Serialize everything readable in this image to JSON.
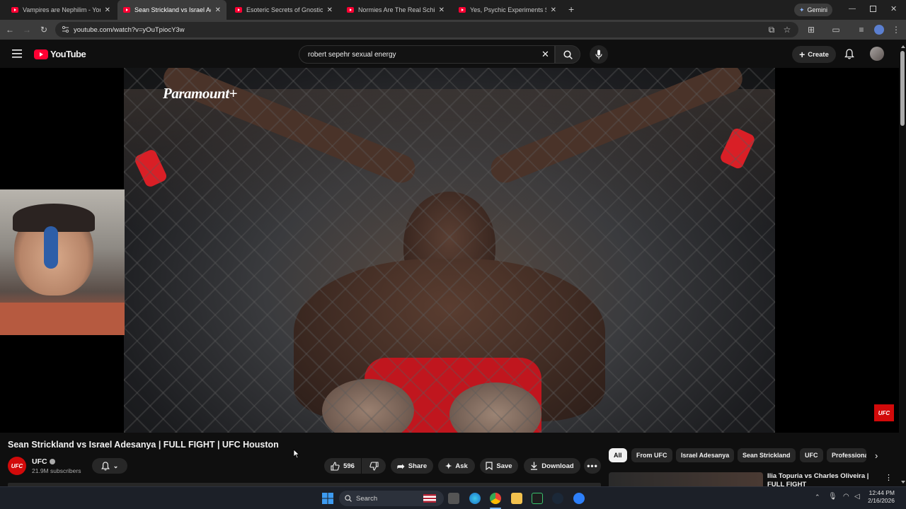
{
  "browser": {
    "tabs": [
      {
        "title": "Vampires are Nephilim - YouTu",
        "active": false
      },
      {
        "title": "Sean Strickland vs Israel Adesa",
        "active": true
      },
      {
        "title": "Esoteric Secrets of Gnostic Bapt",
        "active": false
      },
      {
        "title": "Normies Are The Real Schizos",
        "active": false
      },
      {
        "title": "Yes, Psychic Experiments Still H",
        "active": false
      }
    ],
    "gemini_label": "Gemini",
    "url": "youtube.com/watch?v=yOuTpiocY3w"
  },
  "youtube": {
    "logo_text": "YouTube",
    "search_value": "robert sepehr sexual energy",
    "create_label": "Create"
  },
  "video": {
    "overlay_brand": "Paramount+",
    "corner_logo": "UFC",
    "title": "Sean Strickland vs Israel Adesanya | FULL FIGHT | UFC Houston"
  },
  "channel": {
    "name": "UFC",
    "avatar_text": "UFC",
    "subscribers": "21.9M subscribers"
  },
  "actions": {
    "likes": "596",
    "share": "Share",
    "ask": "Ask",
    "save": "Save",
    "download": "Download"
  },
  "chips": [
    "All",
    "From UFC",
    "Israel Adesanya",
    "Sean Strickland",
    "UFC",
    "Professiona"
  ],
  "recommended": {
    "title": "Ilia Topuria vs Charles Oliveira | FULL FIGHT"
  },
  "taskbar": {
    "search_label": "Search",
    "time": "12:44 PM",
    "date": "2/16/2026"
  },
  "colors": {
    "youtube_red": "#ff0033",
    "ufc_red": "#d20a0a",
    "chip_selected": "#f1f1f1"
  }
}
